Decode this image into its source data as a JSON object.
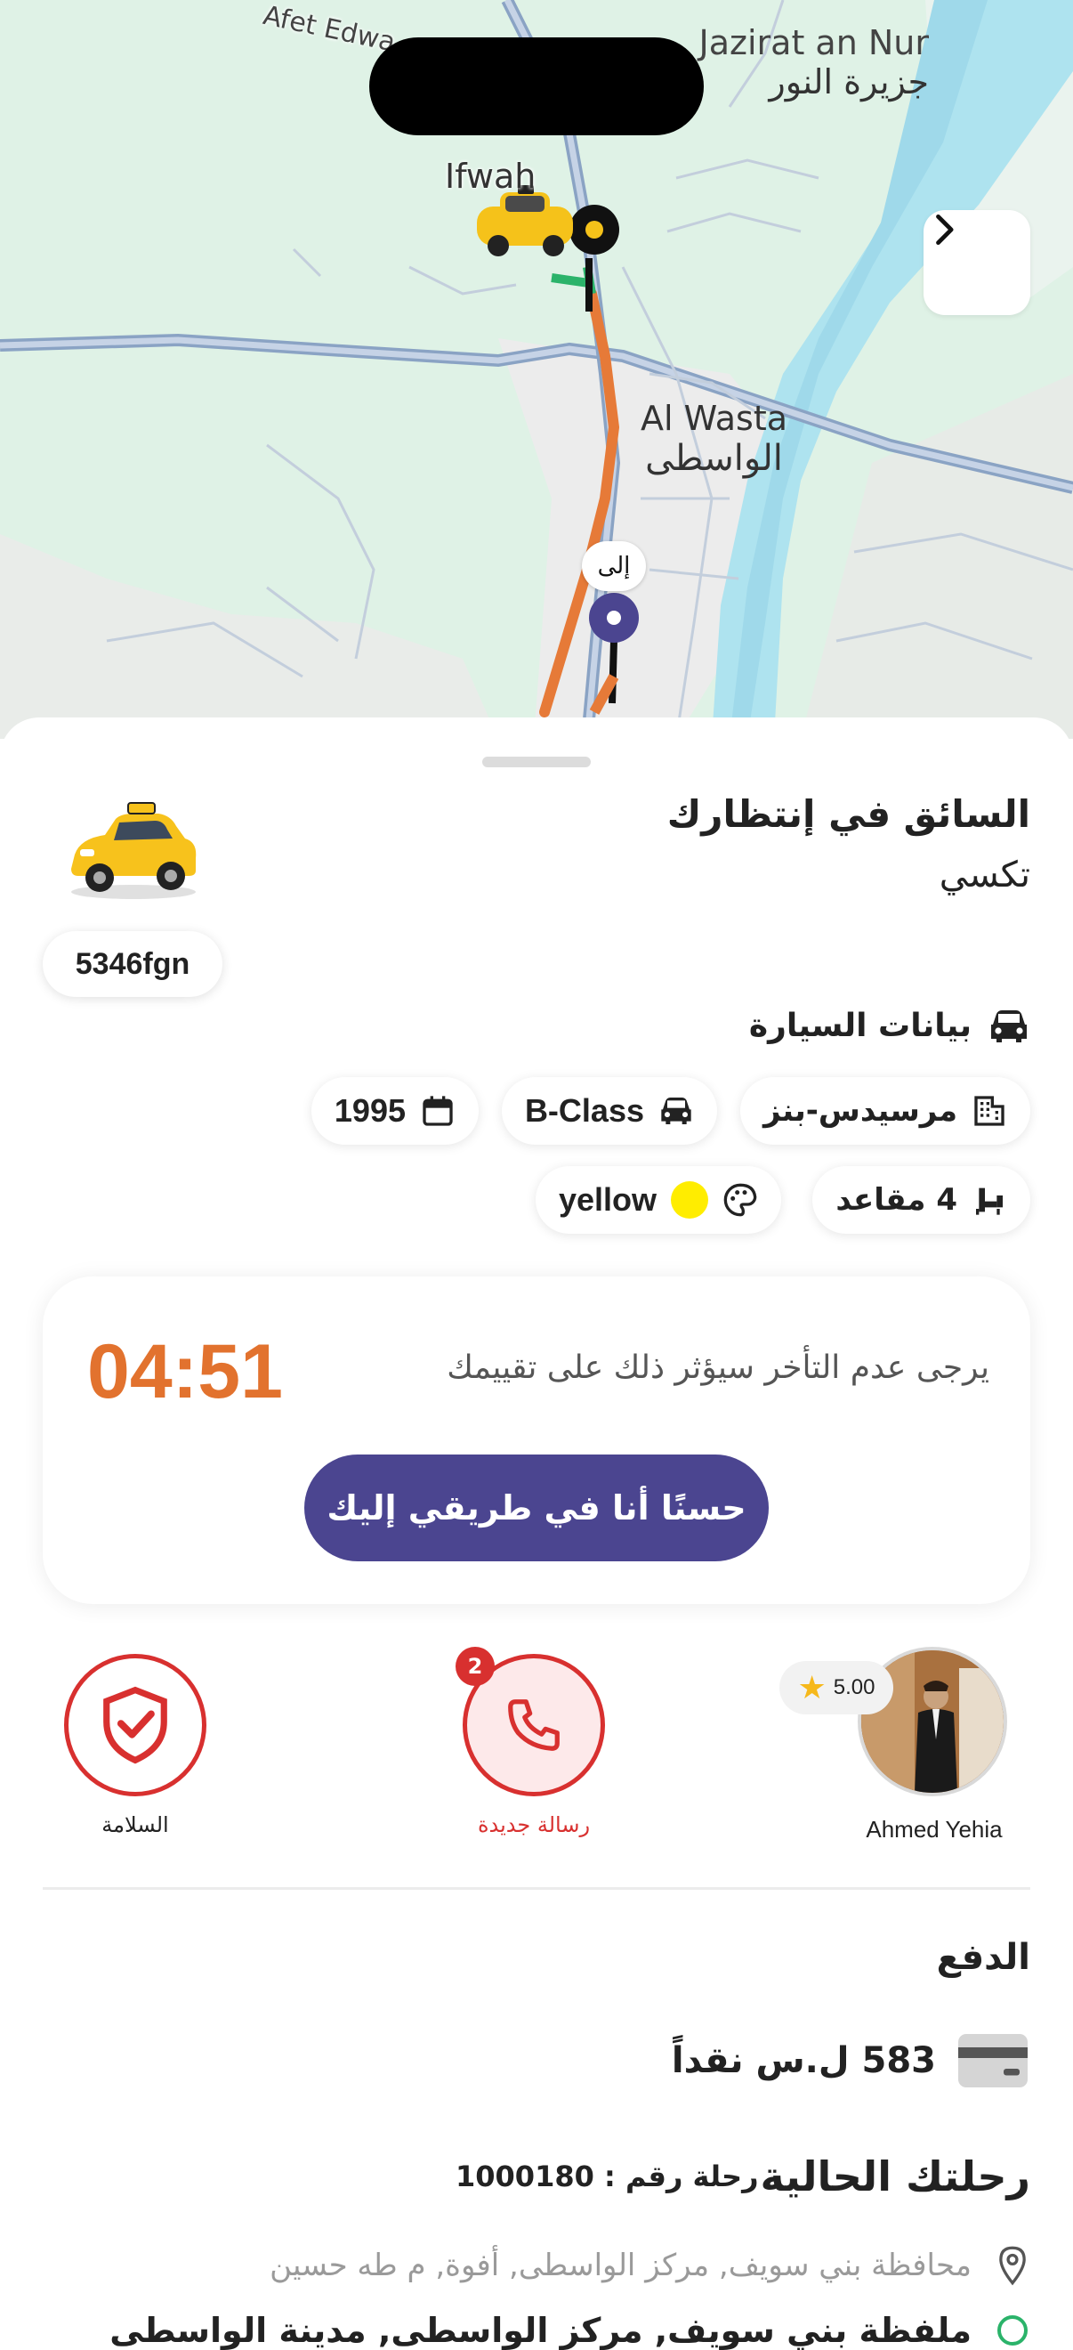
{
  "map": {
    "labels": {
      "island_en": "Jazirat an Nur",
      "island_ar": "جزيرة النور",
      "town_en": "Al Wasta",
      "town_ar": "الواسطى",
      "village_en": "Ifwah",
      "road": "Afet Edwa"
    },
    "destination_tag": "إلى",
    "next_icon": "chevron-right-icon"
  },
  "trip": {
    "status_title": "السائق في إنتظارك",
    "vehicle_type": "تكسي",
    "plate": "5346fgn"
  },
  "car_info": {
    "header": "بيانات السيارة",
    "brand": "مرسيدس-بنز",
    "model": "B-Class",
    "year": "1995",
    "seats": "4 مقاعد",
    "color_name": "yellow",
    "color_hex": "#ffed00"
  },
  "timer_card": {
    "time": "04:51",
    "message": "يرجى عدم التأخر سيؤثر ذلك على تقييمك",
    "button_label": "حسنًا أنا في طريقي إليك"
  },
  "actions": {
    "safety_label": "السلامة",
    "message_label": "رسالة جديدة",
    "message_badge": "2"
  },
  "driver": {
    "name": "Ahmed Yehia",
    "rating": "5.00"
  },
  "payment": {
    "title": "الدفع",
    "amount": "583 ل.س نقداً"
  },
  "current_trip": {
    "title": "رحلتك الحالية",
    "number_label": "رحلة رقم : 1000180",
    "pickup_address": "محافظة بني سويف, مركز الواسطى, أفوة, م طه حسين",
    "dropoff_address": "ملفظة بني سويف, مركز الواسطى, مدينة الواسطى"
  },
  "colors": {
    "accent": "#4b4590",
    "timer": "#e2722e",
    "danger": "#d8302f"
  }
}
